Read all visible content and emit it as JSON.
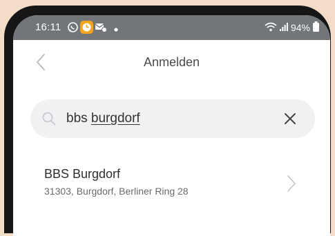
{
  "statusbar": {
    "time": "16:11",
    "battery": "94%"
  },
  "header": {
    "title": "Anmelden"
  },
  "search": {
    "query_prefix": "bbs ",
    "query_underlined": "burgdorf",
    "placeholder": ""
  },
  "results": [
    {
      "title": "BBS Burgdorf",
      "subtitle": "31303, Burgdorf, Berliner Ring 28"
    }
  ],
  "colors": {
    "statusbar": "#727579",
    "search_bg": "#f0f1f3",
    "frame": "#161616"
  }
}
